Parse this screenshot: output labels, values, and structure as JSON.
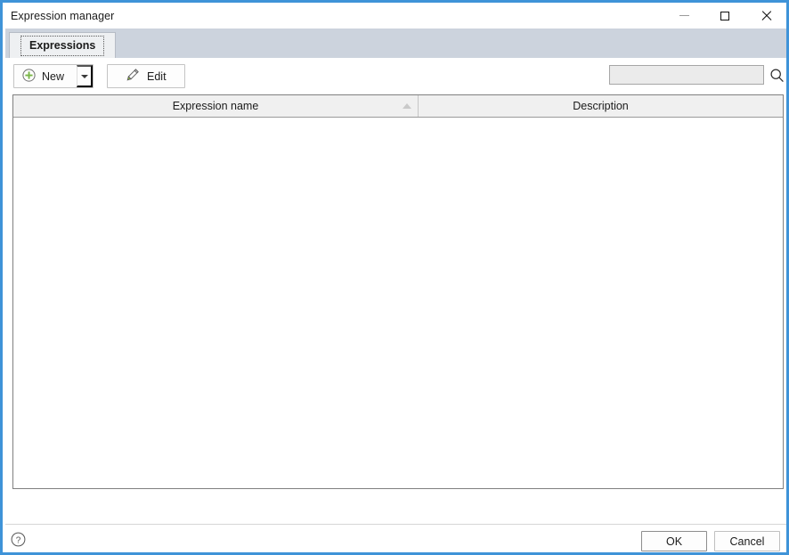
{
  "window": {
    "title": "Expression manager",
    "controls": {
      "minimize": "minimize-icon",
      "maximize": "maximize-icon",
      "close": "close-icon"
    },
    "border_color": "#3f93d8"
  },
  "tabs": [
    {
      "label": "Expressions",
      "active": true
    }
  ],
  "toolbar": {
    "new_button": {
      "label": "New",
      "icon": "plus-circle-icon",
      "icon_color": "#7ab648",
      "has_dropdown": true,
      "dropdown_icon": "chevron-down-icon"
    },
    "edit_button": {
      "label": "Edit",
      "icon": "pencil-icon",
      "icon_color": "#7ab648"
    },
    "search": {
      "value": "",
      "placeholder": "",
      "icon": "search-icon"
    }
  },
  "list": {
    "columns": [
      {
        "label": "Expression name",
        "sort": "ascending",
        "sort_icon": "sort-ascending-icon"
      },
      {
        "label": "Description",
        "sort": "none"
      }
    ],
    "rows": []
  },
  "footer": {
    "help_icon": "help-circle-icon",
    "ok_label": "OK",
    "cancel_label": "Cancel"
  }
}
